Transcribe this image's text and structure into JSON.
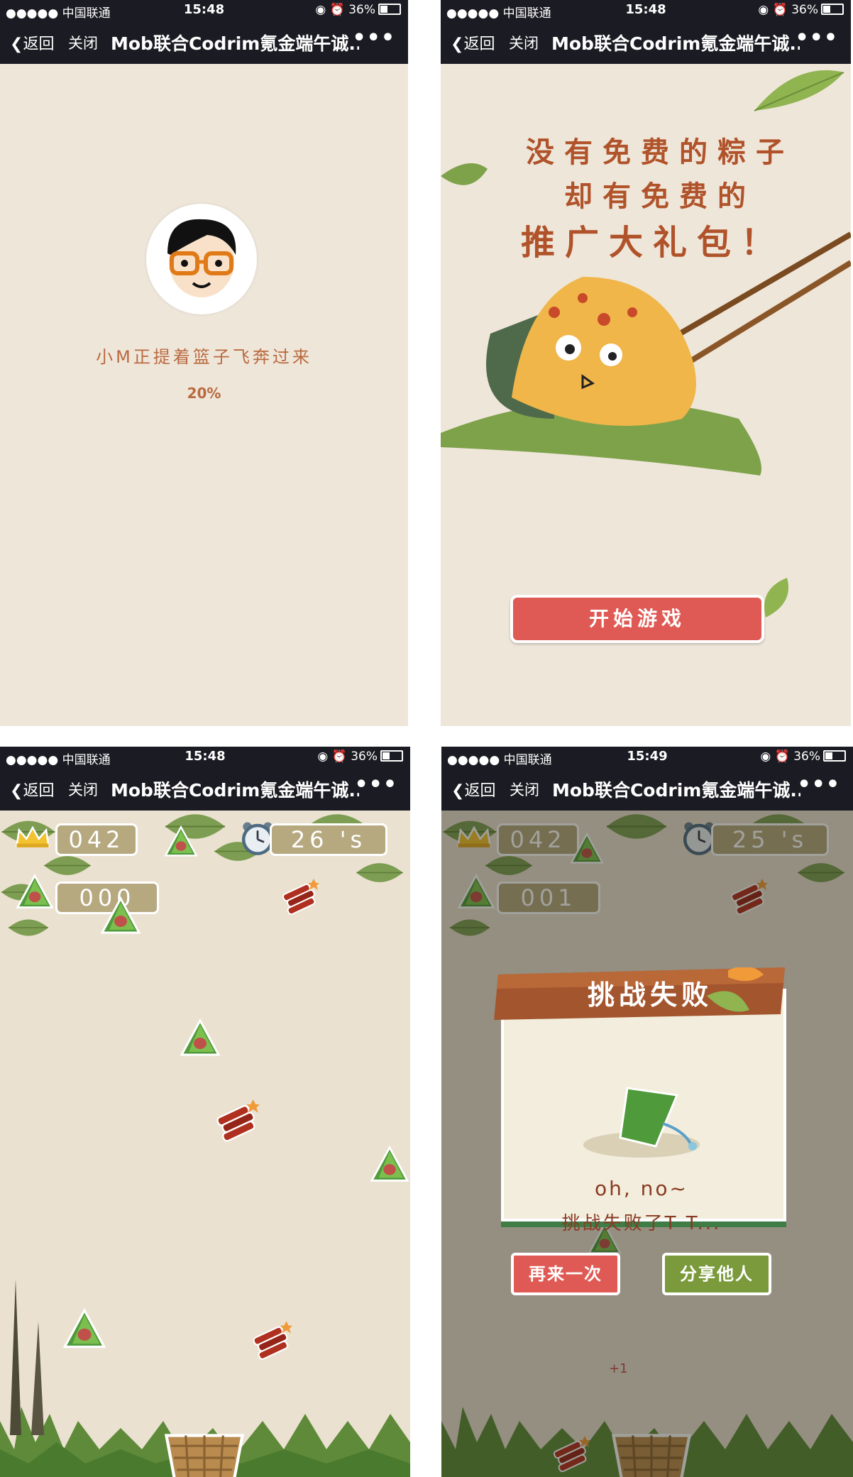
{
  "panels": [
    {
      "status": {
        "carrier": "●●●●● 中国联通",
        "time": "15:48",
        "battery": "36%"
      },
      "nav": {
        "back": "返回",
        "close": "关闭",
        "title": "Mob联合Codrim氪金端午诚...",
        "more": "•••"
      },
      "loading": {
        "text": "小M正提着篮子飞奔过来",
        "percent": "20%"
      }
    },
    {
      "status": {
        "carrier": "●●●●● 中国联通",
        "time": "15:48",
        "battery": "36%"
      },
      "nav": {
        "back": "返回",
        "close": "关闭",
        "title": "Mob联合Codrim氪金端午诚...",
        "more": "•••"
      },
      "slogan": {
        "line1": "没有免费的粽子",
        "line2": "却有免费的",
        "line3": "推广大礼包！"
      },
      "start_button": "开始游戏"
    },
    {
      "status": {
        "carrier": "●●●●● 中国联通",
        "time": "15:48",
        "battery": "36%"
      },
      "nav": {
        "back": "返回",
        "close": "关闭",
        "title": "Mob联合Codrim氪金端午诚...",
        "more": "•••"
      },
      "hud": {
        "best": "042",
        "timer": "26 's",
        "score": "000"
      }
    },
    {
      "status": {
        "carrier": "●●●●● 中国联通",
        "time": "15:49",
        "battery": "36%"
      },
      "nav": {
        "back": "返回",
        "close": "关闭",
        "title": "Mob联合Codrim氪金端午诚...",
        "more": "•••"
      },
      "hud": {
        "best": "042",
        "timer": "25 's",
        "score": "001",
        "plus": "+1"
      },
      "dialog": {
        "title": "挑战失败",
        "line1": "oh, no~",
        "line2": "挑战失败了T T...",
        "retry": "再来一次",
        "share": "分享他人"
      }
    }
  ]
}
